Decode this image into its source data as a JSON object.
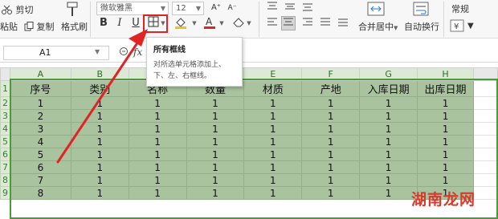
{
  "ribbon": {
    "cut_label": "剪切",
    "paste_label": "粘贴",
    "copy_label": "复制",
    "format_painter_label": "格式刷",
    "font_name": "微软雅黑",
    "font_size": "12",
    "merge_center_label": "合并居中",
    "wrap_text_label": "自动换行",
    "number_format": "常规",
    "bold": "B",
    "italic": "I",
    "underline": "U"
  },
  "tooltip": {
    "title": "所有框线",
    "description": "对所选单元格添加上、下、左、右框线。"
  },
  "formula_bar": {
    "cell_ref": "A1",
    "fx_label": "fx"
  },
  "sheet": {
    "columns": [
      "A",
      "B",
      "C",
      "D",
      "E",
      "F",
      "G",
      "H",
      ""
    ],
    "rows": [
      {
        "num": "1",
        "cells": [
          "序号",
          "类别",
          "名称",
          "数量",
          "材质",
          "产地",
          "入库日期",
          "出库日期",
          ""
        ]
      },
      {
        "num": "2",
        "cells": [
          "1",
          "1",
          "1",
          "1",
          "1",
          "1",
          "1",
          "1",
          ""
        ]
      },
      {
        "num": "3",
        "cells": [
          "2",
          "1",
          "1",
          "1",
          "1",
          "1",
          "1",
          "1",
          ""
        ]
      },
      {
        "num": "4",
        "cells": [
          "3",
          "1",
          "1",
          "1",
          "1",
          "1",
          "1",
          "1",
          ""
        ]
      },
      {
        "num": "5",
        "cells": [
          "4",
          "1",
          "1",
          "1",
          "1",
          "1",
          "1",
          "1",
          ""
        ]
      },
      {
        "num": "6",
        "cells": [
          "5",
          "1",
          "1",
          "1",
          "1",
          "1",
          "1",
          "1",
          ""
        ]
      },
      {
        "num": "7",
        "cells": [
          "6",
          "1",
          "1",
          "1",
          "1",
          "1",
          "1",
          "1",
          ""
        ]
      },
      {
        "num": "8",
        "cells": [
          "7",
          "1",
          "1",
          "1",
          "1",
          "1",
          "1",
          "1",
          ""
        ]
      },
      {
        "num": "9",
        "cells": [
          "8",
          "1",
          "1",
          "1",
          "1",
          "1",
          "1",
          "1",
          ""
        ]
      }
    ]
  },
  "watermark": "湖南龙网",
  "colors": {
    "selection_fill": "#a9c39f",
    "selection_border": "#4a9a3a",
    "arrow_red": "#e02424"
  }
}
